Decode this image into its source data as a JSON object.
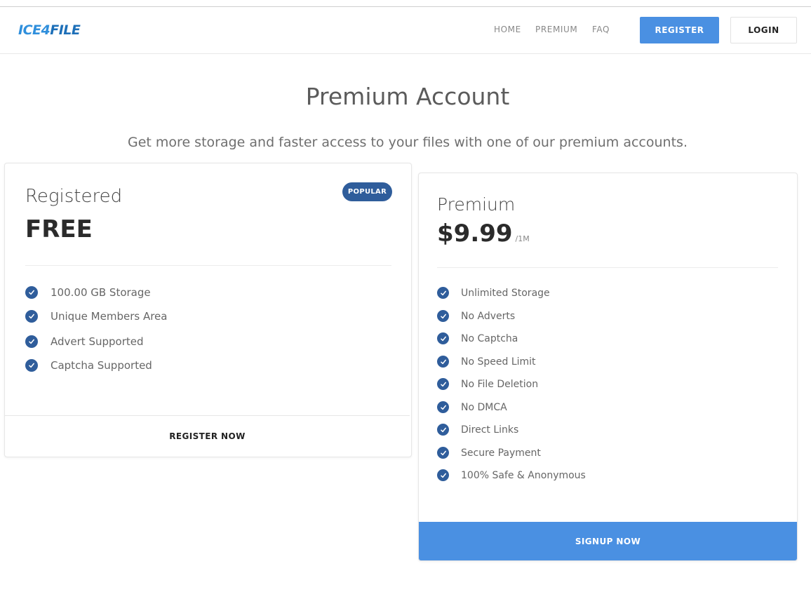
{
  "header": {
    "logo_text_1": "ICE4",
    "logo_text_2": "FILE",
    "nav": [
      "HOME",
      "PREMIUM",
      "FAQ"
    ],
    "register_label": "REGISTER",
    "login_label": "LOGIN"
  },
  "hero": {
    "title": "Premium Account",
    "subtitle": "Get more storage and faster access to your files with one of our premium accounts."
  },
  "plans": {
    "free": {
      "name": "Registered",
      "price": "FREE",
      "badge": "POPULAR",
      "features": [
        "100.00 GB Storage",
        "Unique Members Area",
        "Advert Supported",
        "Captcha Supported"
      ],
      "cta": "REGISTER NOW"
    },
    "premium": {
      "name": "Premium",
      "price": "$9.99",
      "period": "/1M",
      "features": [
        "Unlimited Storage",
        "No Adverts",
        "No Captcha",
        "No Speed Limit",
        "No File Deletion",
        "No DMCA",
        "Direct Links",
        "Secure Payment",
        "100% Safe & Anonymous"
      ],
      "cta": "SIGNUP NOW"
    }
  },
  "colors": {
    "accent": "#4a90e2",
    "badge": "#2f5d9b"
  }
}
